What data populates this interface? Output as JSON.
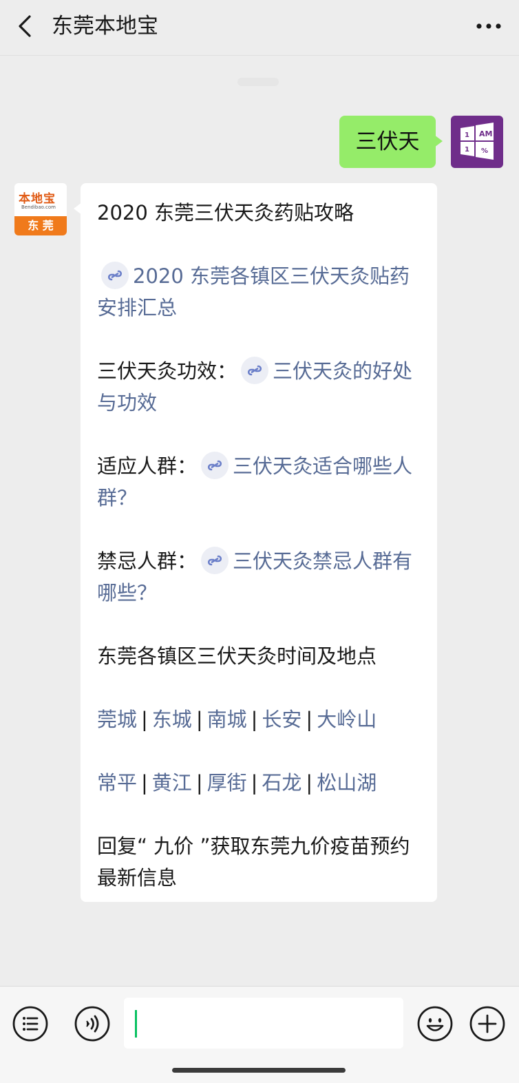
{
  "header": {
    "title": "东莞本地宝",
    "back_icon": "chevron-left-icon",
    "more_icon": "more-horizontal-icon"
  },
  "messages": {
    "outgoing_text": "三伏天",
    "user_avatar": {
      "icon": "windows-am-icon",
      "lines": [
        "1",
        "AM",
        "1",
        "%"
      ],
      "color": "#6f2d8a"
    },
    "bot_avatar": {
      "brand": "本地宝",
      "url": "Bendibao.com",
      "city": "东 莞",
      "color": "#f07a1b"
    }
  },
  "reply": {
    "title": "2020 东莞三伏天灸药贴攻略",
    "link1": "2020 东莞各镇区三伏天灸贴药安排汇总",
    "efficacy_label": "三伏天灸功效：",
    "efficacy_link": "三伏天灸的好处与功效",
    "suitable_label": "适应人群：",
    "suitable_link": "三伏天灸适合哪些人群？",
    "forbidden_label": "禁忌人群：",
    "forbidden_link": "三伏天灸禁忌人群有哪些？",
    "towns_heading": "东莞各镇区三伏天灸时间及地点",
    "towns_row1": [
      "莞城",
      "东城",
      "南城",
      "长安",
      "大岭山"
    ],
    "towns_row2": [
      "常平",
      "黄江",
      "厚街",
      "石龙",
      "松山湖"
    ],
    "separator": "|",
    "reply_hint": "回复“ 九价 ”获取东莞九价疫苗预约最新信息"
  },
  "footer": {
    "menu_icon": "list-menu-icon",
    "voice_icon": "voice-icon",
    "emoji_icon": "emoji-icon",
    "add_icon": "plus-circle-icon",
    "input_value": ""
  },
  "colors": {
    "background": "#ededed",
    "outgoing_bubble": "#95ec69",
    "link": "#576b95",
    "accent": "#07c160"
  }
}
